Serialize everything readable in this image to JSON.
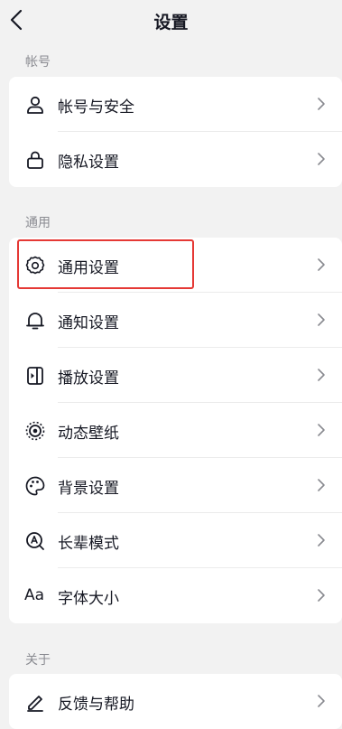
{
  "header": {
    "title": "设置"
  },
  "sections": {
    "account": {
      "label": "帐号",
      "items": [
        {
          "label": "帐号与安全",
          "icon": "user-icon"
        },
        {
          "label": "隐私设置",
          "icon": "lock-icon"
        }
      ]
    },
    "general": {
      "label": "通用",
      "items": [
        {
          "label": "通用设置",
          "icon": "gear-icon"
        },
        {
          "label": "通知设置",
          "icon": "bell-icon"
        },
        {
          "label": "播放设置",
          "icon": "play-icon"
        },
        {
          "label": "动态壁纸",
          "icon": "live-wallpaper-icon"
        },
        {
          "label": "背景设置",
          "icon": "palette-icon"
        },
        {
          "label": "长辈模式",
          "icon": "elder-mode-icon"
        },
        {
          "label": "字体大小",
          "icon": "font-size-icon",
          "icon_text": "Aa"
        }
      ]
    },
    "about": {
      "label": "关于",
      "items": [
        {
          "label": "反馈与帮助",
          "icon": "feedback-icon"
        }
      ]
    }
  },
  "colors": {
    "background": "#f2f2f2",
    "card": "#ffffff",
    "text": "#161823",
    "muted": "#8a8b91",
    "highlight": "#e53935"
  }
}
